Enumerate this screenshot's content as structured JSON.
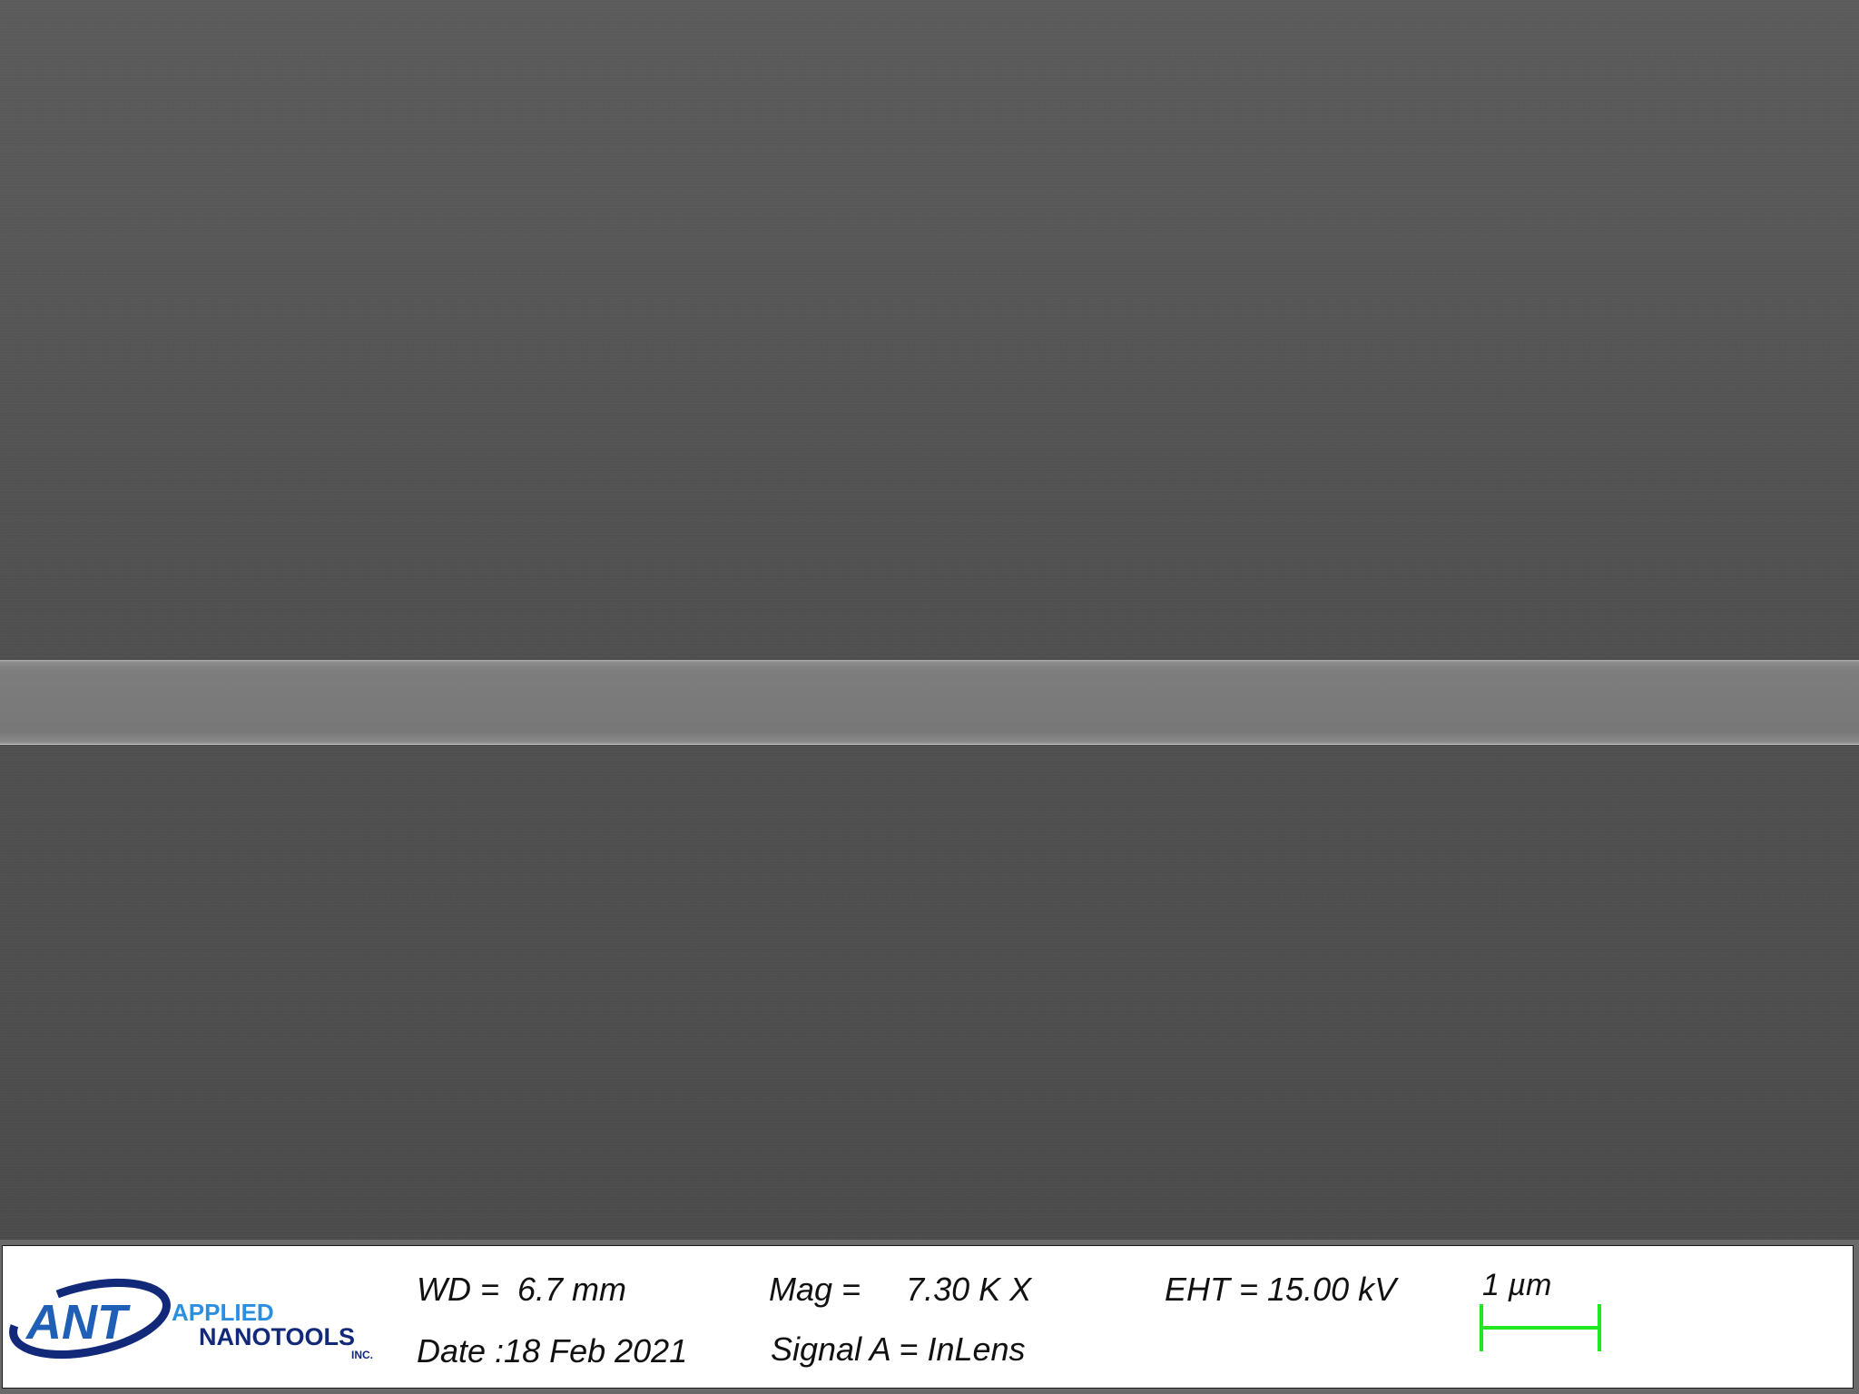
{
  "logo": {
    "mark": "ANT",
    "line1": "APPLIED",
    "line2": "NANOTOOLS",
    "suffix": "INC.",
    "colors": {
      "mark": "#1f5fb5",
      "applied": "#2a8fe0",
      "nanotools": "#12297a"
    }
  },
  "metadata": {
    "wd": "WD =  6.7 mm",
    "date": "Date :18 Feb 2021",
    "mag": "Mag =     7.30 K X",
    "signal": "Signal A = InLens",
    "eht": "EHT = 15.00 kV"
  },
  "scale_bar": {
    "label": "1 µm",
    "color": "#22e822"
  },
  "image": {
    "background_color": "#525252",
    "feature_color": "#7b7b7b"
  }
}
